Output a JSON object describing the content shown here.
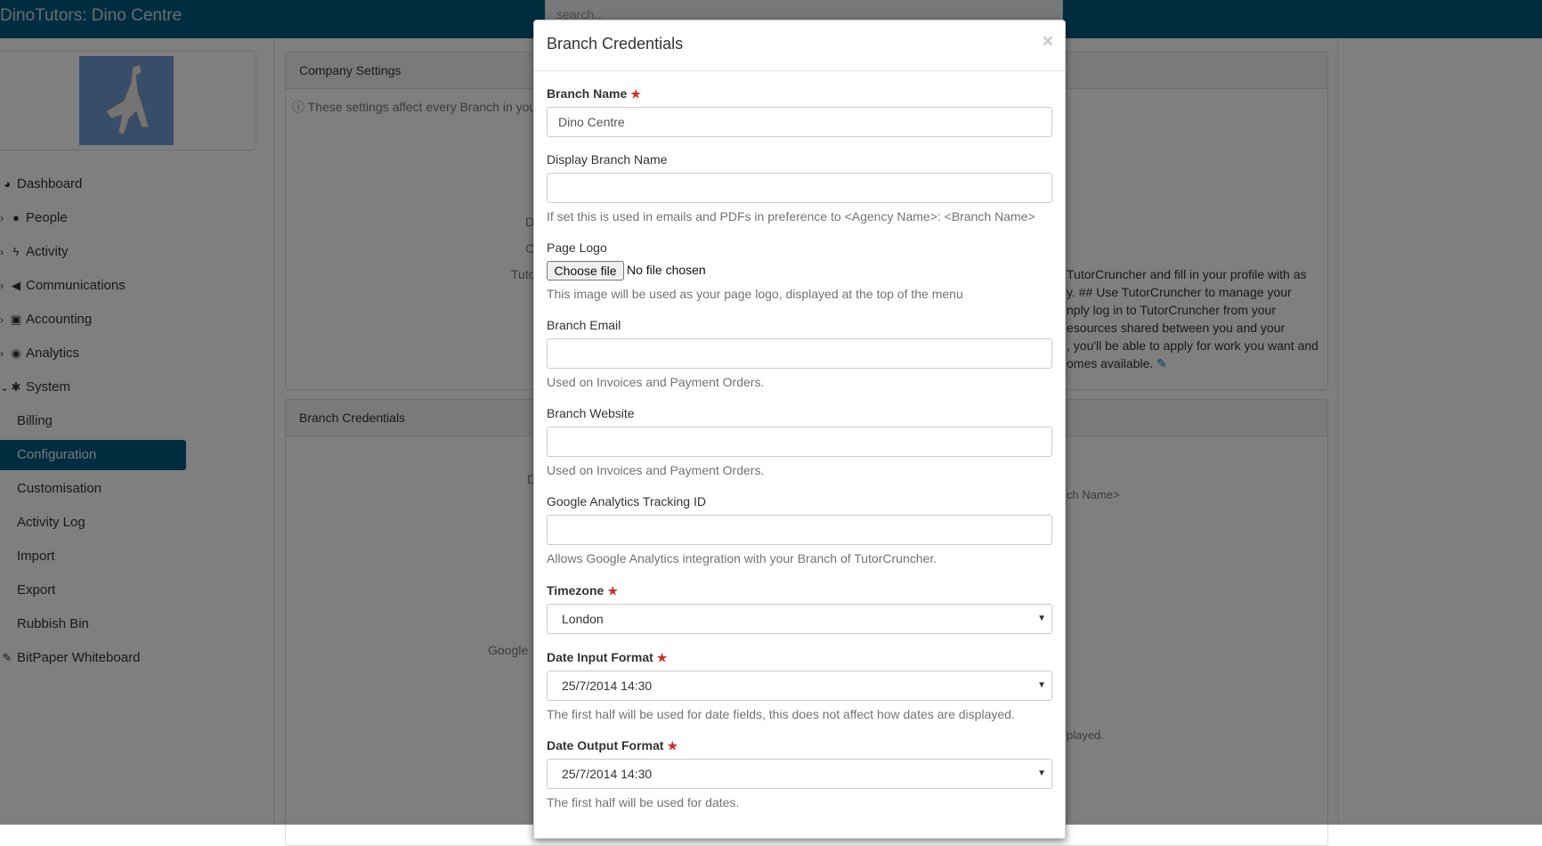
{
  "app": {
    "title": "DinoTutors: Dino Centre",
    "search_placeholder": "search..."
  },
  "sidebar": {
    "items": [
      {
        "label": "Dashboard",
        "icon": "dashboard-icon"
      },
      {
        "label": "People",
        "icon": "user-icon"
      },
      {
        "label": "Activity",
        "icon": "bolt-icon"
      },
      {
        "label": "Communications",
        "icon": "bullhorn-icon"
      },
      {
        "label": "Accounting",
        "icon": "money-icon"
      },
      {
        "label": "Analytics",
        "icon": "eye-icon"
      },
      {
        "label": "System",
        "icon": "cog-icon"
      }
    ],
    "system_subitems": [
      "Billing",
      "Configuration",
      "Customisation",
      "Activity Log",
      "Import",
      "Export",
      "Rubbish Bin"
    ],
    "active_subitem": "Configuration",
    "last_item": {
      "label": "BitPaper Whiteboard",
      "icon": "pencil-icon"
    }
  },
  "background": {
    "company_settings_title": "Company Settings",
    "company_settings_info": "These settings affect every Branch in you",
    "branch_credentials_title": "Branch Credentials",
    "fragments": {
      "d1": "D",
      "c1": "C",
      "tuto": "Tuto",
      "d2": "D",
      "google": "Google",
      "desc1": "TutorCruncher and fill in your profile with as",
      "desc2": "y. ## Use TutorCruncher to manage your",
      "desc3": "nply log in to TutorCruncher from your",
      "desc4": "esources shared between you and your",
      "desc5": ", you'll be able to apply for work you want and",
      "desc6": "omes available.",
      "chname": "ch Name>",
      "played": "played."
    }
  },
  "modal": {
    "title": "Branch Credentials",
    "close": "×",
    "fields": {
      "branch_name": {
        "label": "Branch Name",
        "value": "Dino Centre"
      },
      "display_branch_name": {
        "label": "Display Branch Name",
        "value": "",
        "help": "If set this is used in emails and PDFs in preference to <Agency Name>: <Branch Name>"
      },
      "page_logo": {
        "label": "Page Logo",
        "button": "Choose file",
        "status": "No file chosen",
        "help": "This image will be used as your page logo, displayed at the top of the menu"
      },
      "branch_email": {
        "label": "Branch Email",
        "value": "",
        "help": "Used on Invoices and Payment Orders."
      },
      "branch_website": {
        "label": "Branch Website",
        "value": "",
        "help": "Used on Invoices and Payment Orders."
      },
      "ga_tracking": {
        "label": "Google Analytics Tracking ID",
        "value": "",
        "help": "Allows Google Analytics integration with your Branch of TutorCruncher."
      },
      "timezone": {
        "label": "Timezone",
        "value": "London"
      },
      "date_input_format": {
        "label": "Date Input Format",
        "value": "25/7/2014 14:30",
        "help": "The first half will be used for date fields, this does not affect how dates are displayed."
      },
      "date_output_format": {
        "label": "Date Output Format",
        "value": "25/7/2014 14:30",
        "help": "The first half will be used for dates."
      }
    }
  }
}
